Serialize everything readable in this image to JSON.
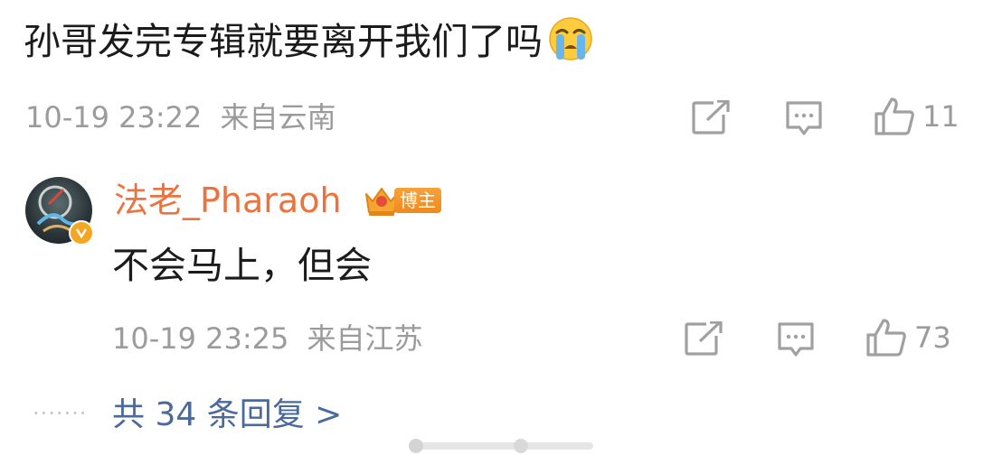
{
  "comment": {
    "text": "孙哥发完专辑就要离开我们了吗",
    "emoji": "crying-face-emoji",
    "date": "10-19 23:22",
    "location": "来自云南",
    "like_count": "11"
  },
  "reply": {
    "username": "法老_Pharaoh",
    "badge_label": "博主",
    "text": "不会马上，但会",
    "date": "10-19 23:25",
    "location": "来自江苏",
    "like_count": "73"
  },
  "more_replies": {
    "dots": "·······",
    "label": "共 34 条回复 >"
  },
  "colors": {
    "username": "#eb7340",
    "link": "#4a6a9a",
    "meta": "#9b9b9b",
    "text": "#1b1b1b",
    "badge": "#f08a1c"
  },
  "icons": [
    "share-icon",
    "comment-icon",
    "like-icon",
    "verified-badge-icon",
    "crown-icon"
  ]
}
